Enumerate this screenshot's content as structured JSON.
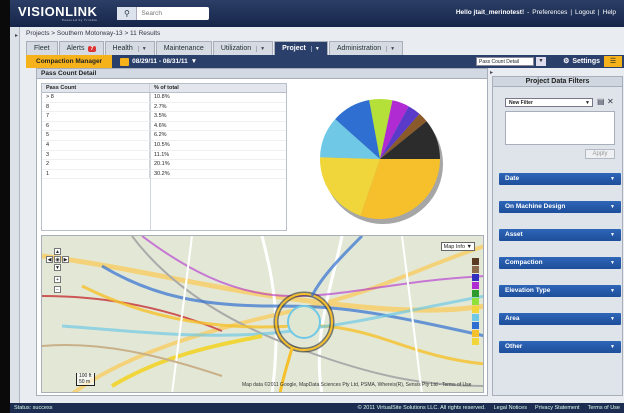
{
  "header": {
    "logo": "VISIONLINK",
    "logo_sub": "Powered by Trimble",
    "search_placeholder": "Search",
    "greeting": "Hello jtait_merinotest!",
    "links": [
      "Preferences",
      "Logout",
      "Help"
    ]
  },
  "breadcrumb": "Projects > Southern Motorway-13 > 11 Results",
  "tabs": [
    {
      "label": "Fleet"
    },
    {
      "label": "Alerts",
      "badge": "7"
    },
    {
      "label": "Health"
    },
    {
      "label": "Maintenance"
    },
    {
      "label": "Utilization"
    },
    {
      "label": "Project"
    },
    {
      "label": "Administration"
    }
  ],
  "subbar": {
    "compaction_label": "Compaction Manager",
    "date_range": "08/29/11 - 08/31/11",
    "view_select": "Pass Count Detail",
    "settings_label": "Settings"
  },
  "panel": {
    "title": "Pass Count Detail",
    "col_pass": "Pass Count",
    "col_pct": "% of total",
    "rows": [
      {
        "pass": "> 8",
        "pct": "10.8%"
      },
      {
        "pass": "8",
        "pct": "2.7%"
      },
      {
        "pass": "7",
        "pct": "3.5%"
      },
      {
        "pass": "6",
        "pct": "4.6%"
      },
      {
        "pass": "5",
        "pct": "6.2%"
      },
      {
        "pass": "4",
        "pct": "10.5%"
      },
      {
        "pass": "3",
        "pct": "11.1%"
      },
      {
        "pass": "2",
        "pct": "20.1%"
      },
      {
        "pass": "1",
        "pct": "30.2%"
      }
    ]
  },
  "chart_data": {
    "type": "pie",
    "categories": [
      "1",
      "2",
      "3",
      "4",
      "5",
      "6",
      "7",
      "8",
      "> 8"
    ],
    "values": [
      30.2,
      20.1,
      11.1,
      10.5,
      6.2,
      4.6,
      3.5,
      2.7,
      10.8
    ],
    "colors": [
      "#f5c02b",
      "#f0d63a",
      "#6fc9e6",
      "#2f6fd1",
      "#b5e03a",
      "#b02bd1",
      "#5a3ac9",
      "#8b5a2b",
      "#2c2c2c"
    ]
  },
  "map": {
    "map_info_label": "Map Info",
    "scale_top": "100 ft",
    "scale_bottom": "50 m",
    "copyright": "Map data ©2011 Google, MapData Sciences Pty Ltd, PSMA, Whereis(R), Sensis Pty Ltd - Terms of Use",
    "swatch_colors": [
      "#5a3a22",
      "#8a6a4a",
      "#2f2fbf",
      "#b02bd1",
      "#2c9a2c",
      "#8fe03a",
      "#f0d63a",
      "#6fc9e6",
      "#2f6fd1",
      "#f5c02b",
      "#f0d63a"
    ]
  },
  "filters": {
    "title": "Project Data Filters",
    "new_filter": "New Filter",
    "apply": "Apply",
    "sections": [
      "Date",
      "On Machine Design",
      "Asset",
      "Compaction",
      "Elevation Type",
      "Area",
      "Other"
    ]
  },
  "status": {
    "text": "Status: success",
    "copyright": "© 2011 VirtualSite Solutions LLC. All rights reserved.",
    "links": [
      "Legal Notices",
      "Privacy Statement",
      "Terms of Use"
    ]
  }
}
